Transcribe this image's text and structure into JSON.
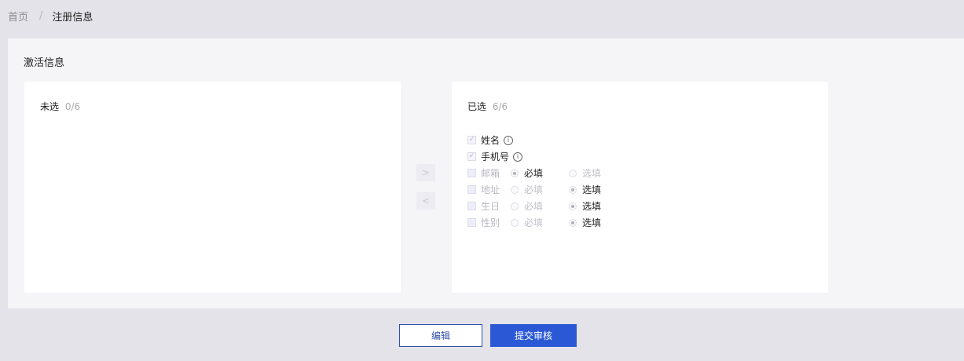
{
  "breadcrumb": {
    "home": "首页",
    "separator": "/",
    "current": "注册信息"
  },
  "panel": {
    "title": "激活信息"
  },
  "unselected": {
    "label": "未选",
    "count": "0/6"
  },
  "selected": {
    "label": "已选",
    "count": "6/6",
    "fields": [
      {
        "name": "姓名",
        "checked": true,
        "info_icon": "info-circle-icon"
      },
      {
        "name": "手机号",
        "checked": true,
        "info_icon": "info-circle-icon"
      },
      {
        "name": "邮箱",
        "checked": false,
        "required_label": "必填",
        "optional_label": "选填",
        "value": "required"
      },
      {
        "name": "地址",
        "checked": false,
        "required_label": "必填",
        "optional_label": "选填",
        "value": "optional"
      },
      {
        "name": "生日",
        "checked": false,
        "required_label": "必填",
        "optional_label": "选填",
        "value": "optional"
      },
      {
        "name": "性别",
        "checked": false,
        "required_label": "必填",
        "optional_label": "选填",
        "value": "optional"
      }
    ]
  },
  "transfer": {
    "right_arrow": ">",
    "left_arrow": "<"
  },
  "actions": {
    "edit_label": "编辑",
    "submit_label": "提交审核"
  },
  "colors": {
    "background": "#e4e3ea",
    "primary": "#2b59d6",
    "edit_border": "#2f4fa8"
  }
}
